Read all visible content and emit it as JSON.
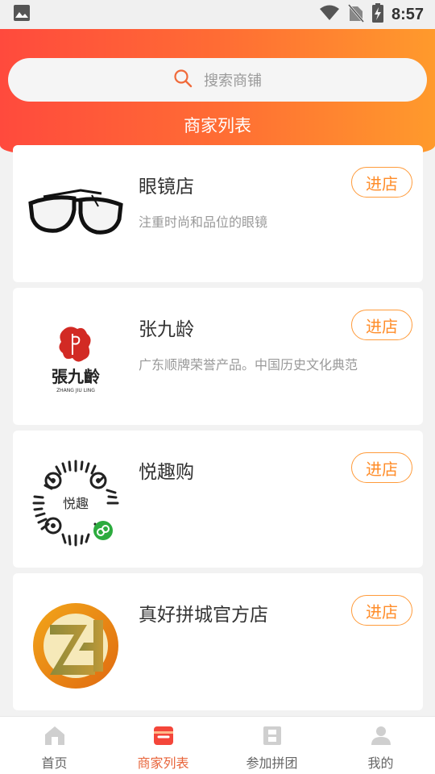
{
  "status_bar": {
    "time": "8:57",
    "icons": [
      "image-icon",
      "wifi-icon",
      "no-sim-icon",
      "battery-charging-icon"
    ]
  },
  "search": {
    "placeholder": "搜索商铺",
    "icon": "search-icon"
  },
  "page_title": "商家列表",
  "shops": [
    {
      "name": "眼镜店",
      "desc": "注重时尚和品位的眼镜",
      "button": "进店",
      "logo": "glasses-logo"
    },
    {
      "name": "张九龄",
      "desc": "广东顺牌荣誉产品。中国历史文化典范",
      "button": "进店",
      "logo": "zhang-jiuling-logo"
    },
    {
      "name": "悦趣购",
      "desc": "",
      "button": "进店",
      "logo": "mini-program-qr-logo"
    },
    {
      "name": "真好拼城官方店",
      "desc": "",
      "button": "进店",
      "logo": "zh-circle-logo"
    }
  ],
  "bottom_nav": [
    {
      "label": "首页",
      "icon": "home-icon",
      "active": false
    },
    {
      "label": "商家列表",
      "icon": "shop-icon",
      "active": true
    },
    {
      "label": "参加拼团",
      "icon": "group-icon",
      "active": false
    },
    {
      "label": "我的",
      "icon": "user-icon",
      "active": false
    }
  ],
  "colors": {
    "header_start": "#ff4a3d",
    "header_end": "#ff9a2c",
    "accent": "#ff8d2a",
    "active_nav": "#e8643a"
  }
}
